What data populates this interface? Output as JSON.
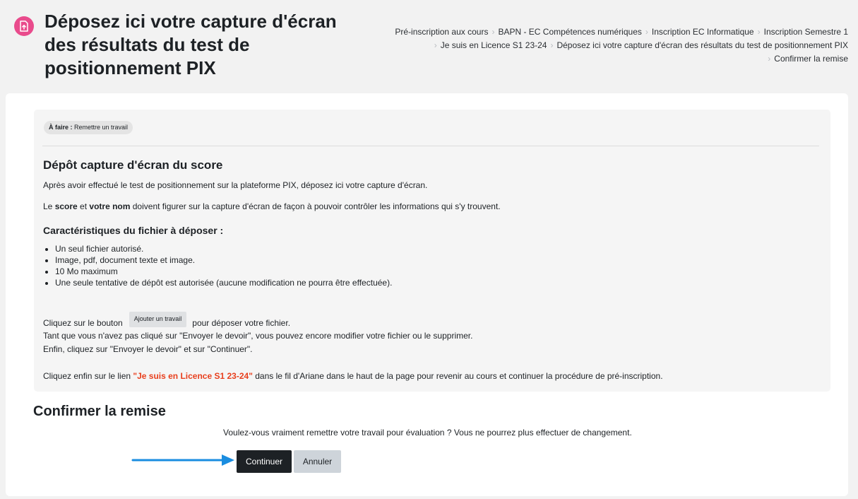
{
  "header": {
    "title": "Déposez ici votre capture d'écran des résultats du test de positionnement PIX",
    "icon": "assignment-upload-icon",
    "icon_color": "#e94b8c"
  },
  "breadcrumb": [
    "Pré-inscription aux cours",
    "BAPN - EC Compétences numériques",
    "Inscription EC Informatique",
    "Inscription Semestre 1",
    "Je suis en Licence S1 23-24",
    "Déposez ici votre capture d'écran des résultats du test de positionnement PIX",
    "Confirmer la remise"
  ],
  "intro": {
    "todo_label": "À faire :",
    "todo_text": "Remettre un travail",
    "title": "Dépôt capture d'écran du score",
    "p1": "Après avoir effectué le test de positionnement sur la plateforme PIX, déposez ici votre capture d'écran.",
    "p2_pre": "Le ",
    "p2_score": "score",
    "p2_mid": " et ",
    "p2_name": "votre nom",
    "p2_post": " doivent figurer sur la capture d'écran de façon à pouvoir contrôler les informations qui s'y trouvent.",
    "subhead": "Caractéristiques du fichier à déposer :",
    "list": [
      "Un seul fichier autorisé.",
      "Image, pdf, document texte et image.",
      "10 Mo maximum",
      "Une seule tentative de dépôt est autorisée (aucune modification ne pourra être effectuée)."
    ],
    "btn_line_pre": "Cliquez sur le bouton",
    "btn_label": "Ajouter un travail",
    "btn_line_post": "pour déposer votre fichier.",
    "p4": "Tant que vous n'avez pas cliqué sur \"Envoyer le devoir\", vous pouvez encore modifier votre fichier ou le supprimer.",
    "p5": "Enfin, cliquez sur \"Envoyer le devoir\" et sur \"Continuer\".",
    "p6_pre": "Cliquez enfin sur le lien ",
    "p6_link": "\"Je suis en Licence S1 23-24\"",
    "p6_post": " dans le fil d'Ariane dans le haut de la page pour revenir au cours et continuer la procédure de pré-inscription."
  },
  "confirm": {
    "title": "Confirmer la remise",
    "text": "Voulez-vous vraiment remettre votre travail pour évaluation ? Vous ne pourrez plus effectuer de changement.",
    "continue_label": "Continuer",
    "cancel_label": "Annuler"
  },
  "colors": {
    "accent_link": "#e83f1d",
    "arrow": "#1a8de0",
    "primary_button": "#1d2125"
  }
}
